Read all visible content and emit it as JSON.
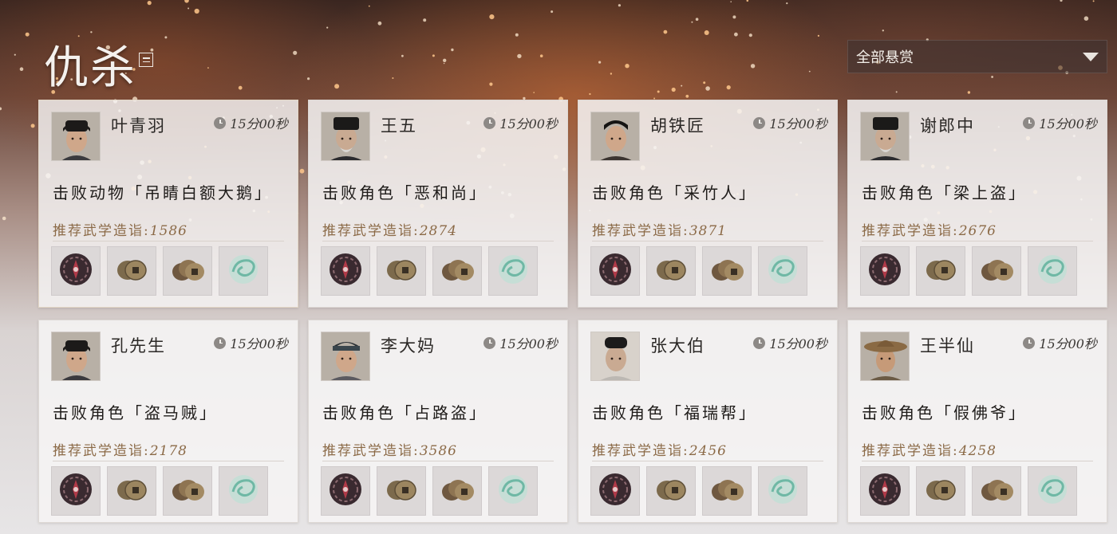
{
  "header": {
    "title": "仇杀",
    "filter_label": "全部悬赏"
  },
  "cards": [
    {
      "name": "叶青羽",
      "timer": "15分00秒",
      "task": "击败动物「吊睛白额大鹅」",
      "rec_label": "推荐武学造诣:",
      "rec_value": "1586",
      "avatar": "young-man",
      "selected": true
    },
    {
      "name": "王五",
      "timer": "15分00秒",
      "task": "击败角色「恶和尚」",
      "rec_label": "推荐武学造诣:",
      "rec_value": "2874",
      "avatar": "old-man-beard"
    },
    {
      "name": "胡铁匠",
      "timer": "15分00秒",
      "task": "击败角色「采竹人」",
      "rec_label": "推荐武学造诣:",
      "rec_value": "3871",
      "avatar": "man-moustache"
    },
    {
      "name": "谢郎中",
      "timer": "15分00秒",
      "task": "击败角色「梁上盗」",
      "rec_label": "推荐武学造诣:",
      "rec_value": "2676",
      "avatar": "old-man-beard"
    },
    {
      "name": "孔先生",
      "timer": "15分00秒",
      "task": "击败角色「盗马贼」",
      "rec_label": "推荐武学造诣:",
      "rec_value": "2178",
      "avatar": "young-man"
    },
    {
      "name": "李大妈",
      "timer": "15分00秒",
      "task": "击败角色「占路盗」",
      "rec_label": "推荐武学造诣:",
      "rec_value": "3586",
      "avatar": "woman-headband"
    },
    {
      "name": "张大伯",
      "timer": "15分00秒",
      "task": "击败角色「福瑞帮」",
      "rec_label": "推荐武学造诣:",
      "rec_value": "2456",
      "avatar": "old-man-white"
    },
    {
      "name": "王半仙",
      "timer": "15分00秒",
      "task": "击败角色「假佛爷」",
      "rec_label": "推荐武学造诣:",
      "rec_value": "4258",
      "avatar": "man-straw-hat"
    }
  ],
  "reward_icons": [
    "dark-seal-icon",
    "copper-coins-icon",
    "copper-coins-stack-icon",
    "jade-swirl-icon"
  ],
  "colors": {
    "accent_gold": "#8b6a47",
    "card_bg": "#f6f5f5",
    "title": "#f4f1ee"
  }
}
